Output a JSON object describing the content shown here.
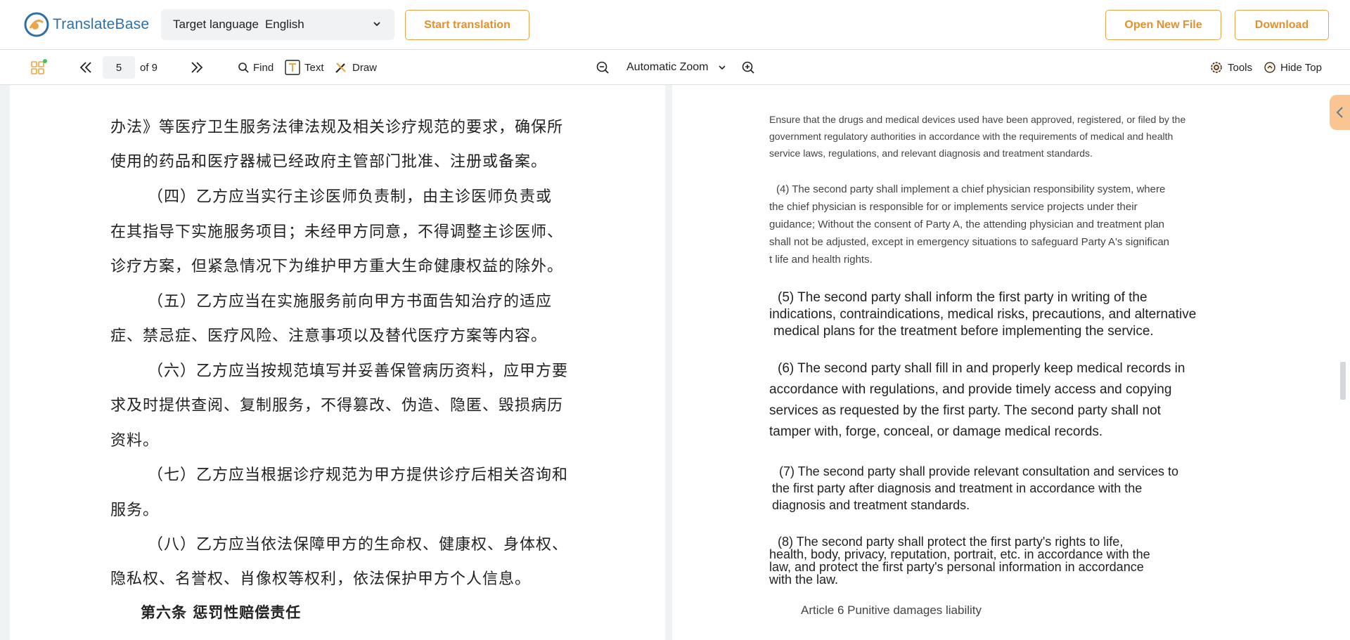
{
  "app": {
    "name": "TranslateBase"
  },
  "header": {
    "target_language_label": "Target language",
    "target_language_value": "English",
    "start_translation": "Start translation",
    "open_new_file": "Open New File",
    "download": "Download"
  },
  "toolbar": {
    "page_current": "5",
    "page_total": "of 9",
    "find": "Find",
    "text": "Text",
    "draw": "Draw",
    "zoom": "Automatic Zoom",
    "tools": "Tools",
    "hide_top": "Hide Top"
  },
  "left_doc": {
    "lines": [
      "办法》等医疗卫生服务法律法规及相关诊疗规范的要求，确保所",
      "使用的药品和医疗器械已经政府主管部门批准、注册或备案。",
      "（四）乙方应当实行主诊医师负责制，由主诊医师负责或",
      "在其指导下实施服务项目；未经甲方同意，不得调整主诊医师、",
      "诊疗方案，但紧急情况下为维护甲方重大生命健康权益的除外。",
      "（五）乙方应当在实施服务前向甲方书面告知治疗的适应",
      "症、禁忌症、医疗风险、注意事项以及替代医疗方案等内容。",
      "（六）乙方应当按规范填写并妥善保管病历资料，应甲方要",
      "求及时提供查阅、复制服务，不得篡改、伪造、隐匿、毁损病历",
      "资料。",
      "（七）乙方应当根据诊疗规范为甲方提供诊疗后相关咨询和",
      "服务。",
      "（八）乙方应当依法保障甲方的生命权、健康权、身体权、",
      "隐私权、名誉权、肖像权等权利，依法保护甲方个人信息。",
      "第六条  惩罚性赔偿责任"
    ]
  },
  "right_doc": {
    "lines": [
      "Ensure that the drugs and medical devices used have been approved, registered, or filed by the",
      "government regulatory authorities in accordance with the requirements of medical and health",
      "service laws, regulations, and relevant diagnosis and treatment standards.",
      "(4)   The second party shall implement a chief physician responsibility system, where",
      "the chief physician is responsible for or implements service projects under their",
      "guidance; Without the consent of Party A, the attending physician and treatment plan",
      "shall not be adjusted, except in emergency situations to safeguard Party A's significan",
      "t life and health rights.",
      "(5)   The second party shall inform the first party in writing of the",
      "indications, contraindications, medical risks, precautions, and alternative",
      "medical plans for the treatment before implementing the service.",
      "(6)   The second party shall fill in and properly keep medical records in",
      "accordance with regulations, and provide timely access and copying",
      "services as requested by the first party. The second party shall not",
      "tamper with, forge, conceal, or damage medical records.",
      "(7)   The second party shall provide relevant consultation and services to",
      "the first party after diagnosis and treatment in accordance with the",
      "diagnosis and treatment standards.",
      "(8)   The second party shall protect the first party's rights to life,",
      "health, body, privacy, reputation, portrait, etc. in accordance with the",
      "law, and protect the first party's personal information in accordance",
      "with the law.",
      "Article 6 Punitive damages liability"
    ]
  }
}
